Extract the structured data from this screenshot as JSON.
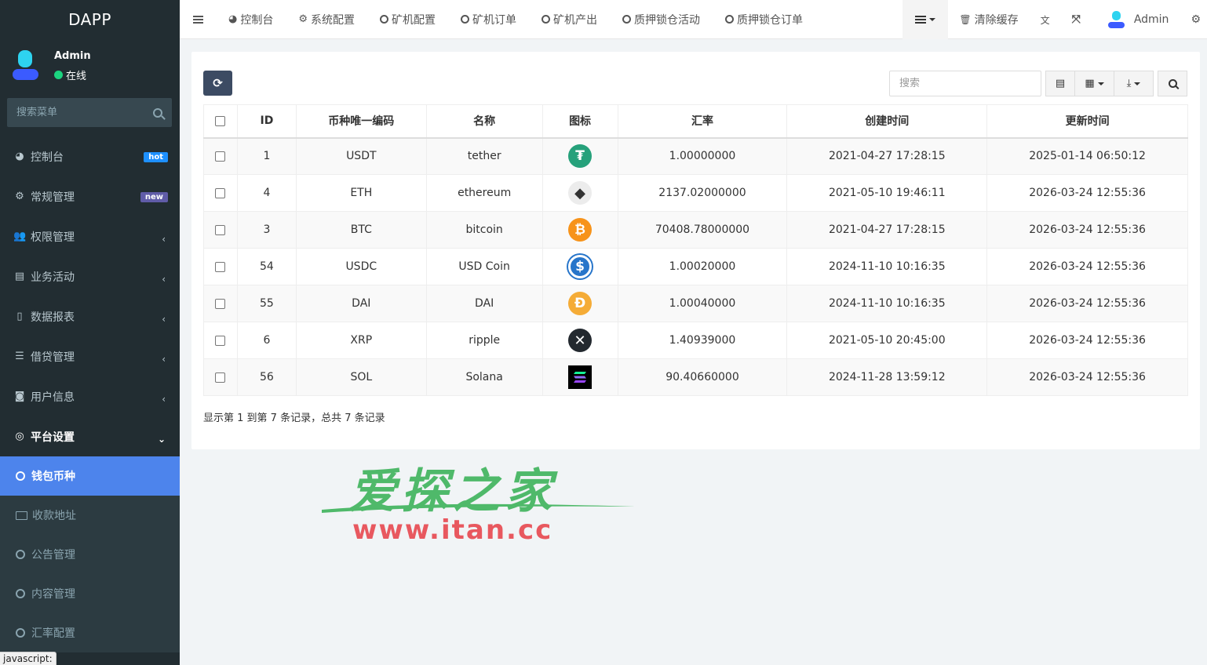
{
  "app": {
    "brand": "DAPP"
  },
  "user": {
    "name": "Admin",
    "status": "在线"
  },
  "sidebar": {
    "search_placeholder": "搜索菜单",
    "items": [
      {
        "label": "控制台",
        "badge": "hot"
      },
      {
        "label": "常规管理",
        "badge": "new"
      },
      {
        "label": "权限管理"
      },
      {
        "label": "业务活动"
      },
      {
        "label": "数据报表"
      },
      {
        "label": "借贷管理"
      },
      {
        "label": "用户信息"
      },
      {
        "label": "平台设置"
      }
    ],
    "subitems": [
      {
        "label": "钱包币种",
        "active": true
      },
      {
        "label": "收款地址"
      },
      {
        "label": "公告管理"
      },
      {
        "label": "内容管理"
      },
      {
        "label": "汇率配置"
      }
    ]
  },
  "topnav": {
    "tabs": [
      "控制台",
      "系统配置",
      "矿机配置",
      "矿机订单",
      "矿机产出",
      "质押锁仓活动",
      "质押锁仓订单"
    ],
    "clear_cache": "清除缓存",
    "admin": "Admin"
  },
  "toolbar": {
    "search_placeholder": "搜索"
  },
  "table": {
    "headers": [
      "ID",
      "币种唯一编码",
      "名称",
      "图标",
      "汇率",
      "创建时间",
      "更新时间"
    ],
    "rows": [
      {
        "id": "1",
        "code": "USDT",
        "name": "tether",
        "icon": "tether-icon",
        "rate": "1.00000000",
        "created": "2021-04-27 17:28:15",
        "updated": "2025-01-14 06:50:12"
      },
      {
        "id": "4",
        "code": "ETH",
        "name": "ethereum",
        "icon": "ethereum-icon",
        "rate": "2137.02000000",
        "created": "2021-05-10 19:46:11",
        "updated": "2026-03-24 12:55:36"
      },
      {
        "id": "3",
        "code": "BTC",
        "name": "bitcoin",
        "icon": "bitcoin-icon",
        "rate": "70408.78000000",
        "created": "2021-04-27 17:28:15",
        "updated": "2026-03-24 12:55:36"
      },
      {
        "id": "54",
        "code": "USDC",
        "name": "USD Coin",
        "icon": "usdc-icon",
        "rate": "1.00020000",
        "created": "2024-11-10 10:16:35",
        "updated": "2026-03-24 12:55:36"
      },
      {
        "id": "55",
        "code": "DAI",
        "name": "DAI",
        "icon": "dai-icon",
        "rate": "1.00040000",
        "created": "2024-11-10 10:16:35",
        "updated": "2026-03-24 12:55:36"
      },
      {
        "id": "6",
        "code": "XRP",
        "name": "ripple",
        "icon": "xrp-icon",
        "rate": "1.40939000",
        "created": "2021-05-10 20:45:00",
        "updated": "2026-03-24 12:55:36"
      },
      {
        "id": "56",
        "code": "SOL",
        "name": "Solana",
        "icon": "solana-icon",
        "rate": "90.40660000",
        "created": "2024-11-28 13:59:12",
        "updated": "2026-03-24 12:55:36"
      }
    ]
  },
  "pager": {
    "text": "显示第 1 到第 7 条记录，总共 7 条记录"
  },
  "watermark": {
    "cn": "爱探之家",
    "url": "www.itan.cc"
  },
  "status_tip": "javascript:"
}
